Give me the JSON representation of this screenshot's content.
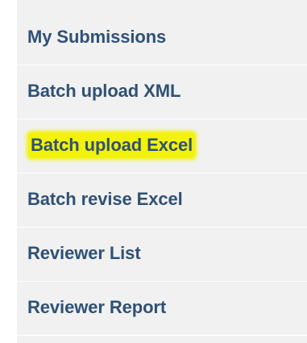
{
  "nav": {
    "items": [
      {
        "label": "My Submissions"
      },
      {
        "label": "Batch upload XML"
      },
      {
        "label": "Batch upload Excel"
      },
      {
        "label": "Batch revise Excel"
      },
      {
        "label": "Reviewer List"
      },
      {
        "label": "Reviewer Report"
      }
    ]
  },
  "colors": {
    "link": "#2f5175",
    "panel_background": "#f1f1f1",
    "highlight": "#f2f20a"
  }
}
